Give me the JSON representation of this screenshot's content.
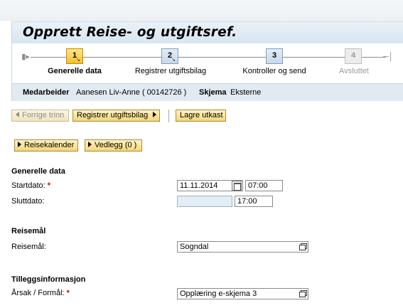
{
  "page": {
    "title": "Opprett Reise- og utgiftsref."
  },
  "roadmap": {
    "steps": [
      {
        "number": "1",
        "label": "Generelle data",
        "state": "active"
      },
      {
        "number": "2",
        "label": "Registrer utgiftsbilag",
        "state": "available"
      },
      {
        "number": "3",
        "label": "Kontroller og send",
        "state": "available"
      },
      {
        "number": "4",
        "label": "Avsluttet",
        "state": "disabled"
      }
    ]
  },
  "info_bar": {
    "employee_label": "Medarbeider",
    "employee_value": "Aanesen Liv-Anne ( 00142726 )",
    "schema_label": "Skjema",
    "schema_value": "Eksterne"
  },
  "toolbar": {
    "previous_label": "Forrige trinn",
    "next_label": "Registrer utgiftsbilag",
    "save_draft_label": "Lagre utkast"
  },
  "actions": {
    "travel_calendar_label": "Reisekalender",
    "attachments_label": "Vedlegg (0 )"
  },
  "general": {
    "section_title": "Generelle data",
    "start_label": "Startdato:",
    "start_date": "11.11.2014",
    "start_time": "07:00",
    "end_label": "Sluttdato:",
    "end_date": "",
    "end_time": "17:00"
  },
  "destination": {
    "section_title": "Reisemål",
    "label": "Reisemål:",
    "value": "Sogndal"
  },
  "additional": {
    "section_title": "Tilleggsinformasjon",
    "reason_label": "Årsak / Formål:",
    "reason_value": "Opplæring e-skjema 3"
  },
  "required_marker": "*",
  "colors": {
    "active_step": "#f3bf2c",
    "button_bg": "#f5d676",
    "info_bar_bg": "#e2eaf1",
    "title_bar_bg": "#d7e6f1",
    "required": "#d40000"
  }
}
